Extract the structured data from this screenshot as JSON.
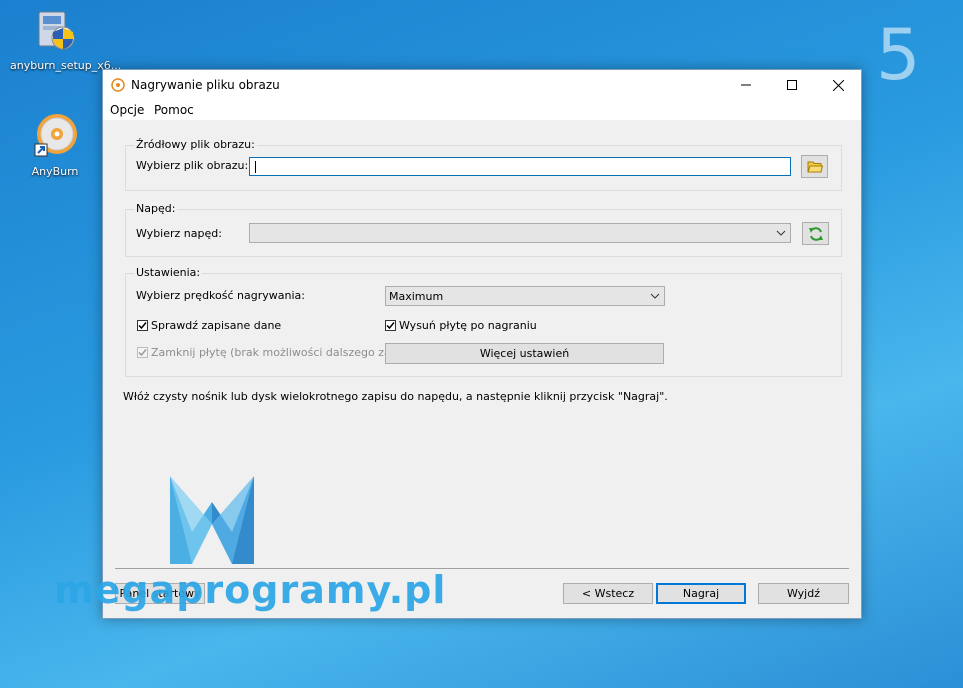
{
  "desktop": {
    "icons": [
      {
        "label": "anyburn_setup_x6..."
      },
      {
        "label": "AnyBurn"
      }
    ],
    "step_number": "5"
  },
  "window": {
    "title": "Nagrywanie pliku obrazu",
    "menu": [
      "Opcje",
      "Pomoc"
    ],
    "source_group": {
      "label": "Źródłowy plik obrazu:",
      "field_label": "Wybierz plik obrazu:",
      "value": ""
    },
    "drive_group": {
      "label": "Napęd:",
      "field_label": "Wybierz napęd:",
      "value": ""
    },
    "settings_group": {
      "label": "Ustawienia:",
      "speed_label": "Wybierz prędkość nagrywania:",
      "speed_value": "Maximum",
      "verify_label": "Sprawdź zapisane dane",
      "verify_checked": true,
      "eject_label": "Wysuń płytę po nagraniu",
      "eject_checked": true,
      "close_disc_label": "Zamknij płytę (brak możliwości dalszego zapisu)",
      "close_disc_checked": true,
      "more_settings_label": "Więcej ustawień"
    },
    "info_text": "Włóż czysty nośnik lub dysk wielokrotnego zapisu do napędu, a następnie kliknij przycisk \"Nagraj\".",
    "footer": {
      "start_panel_label": "Panel startowy",
      "back_label": "< Wstecz",
      "burn_label": "Nagraj",
      "exit_label": "Wyjdź"
    }
  },
  "watermark": {
    "text": "megaprogramy.pl"
  },
  "colors": {
    "accent": "#0078d7",
    "watermark": "#2ba6e6"
  }
}
